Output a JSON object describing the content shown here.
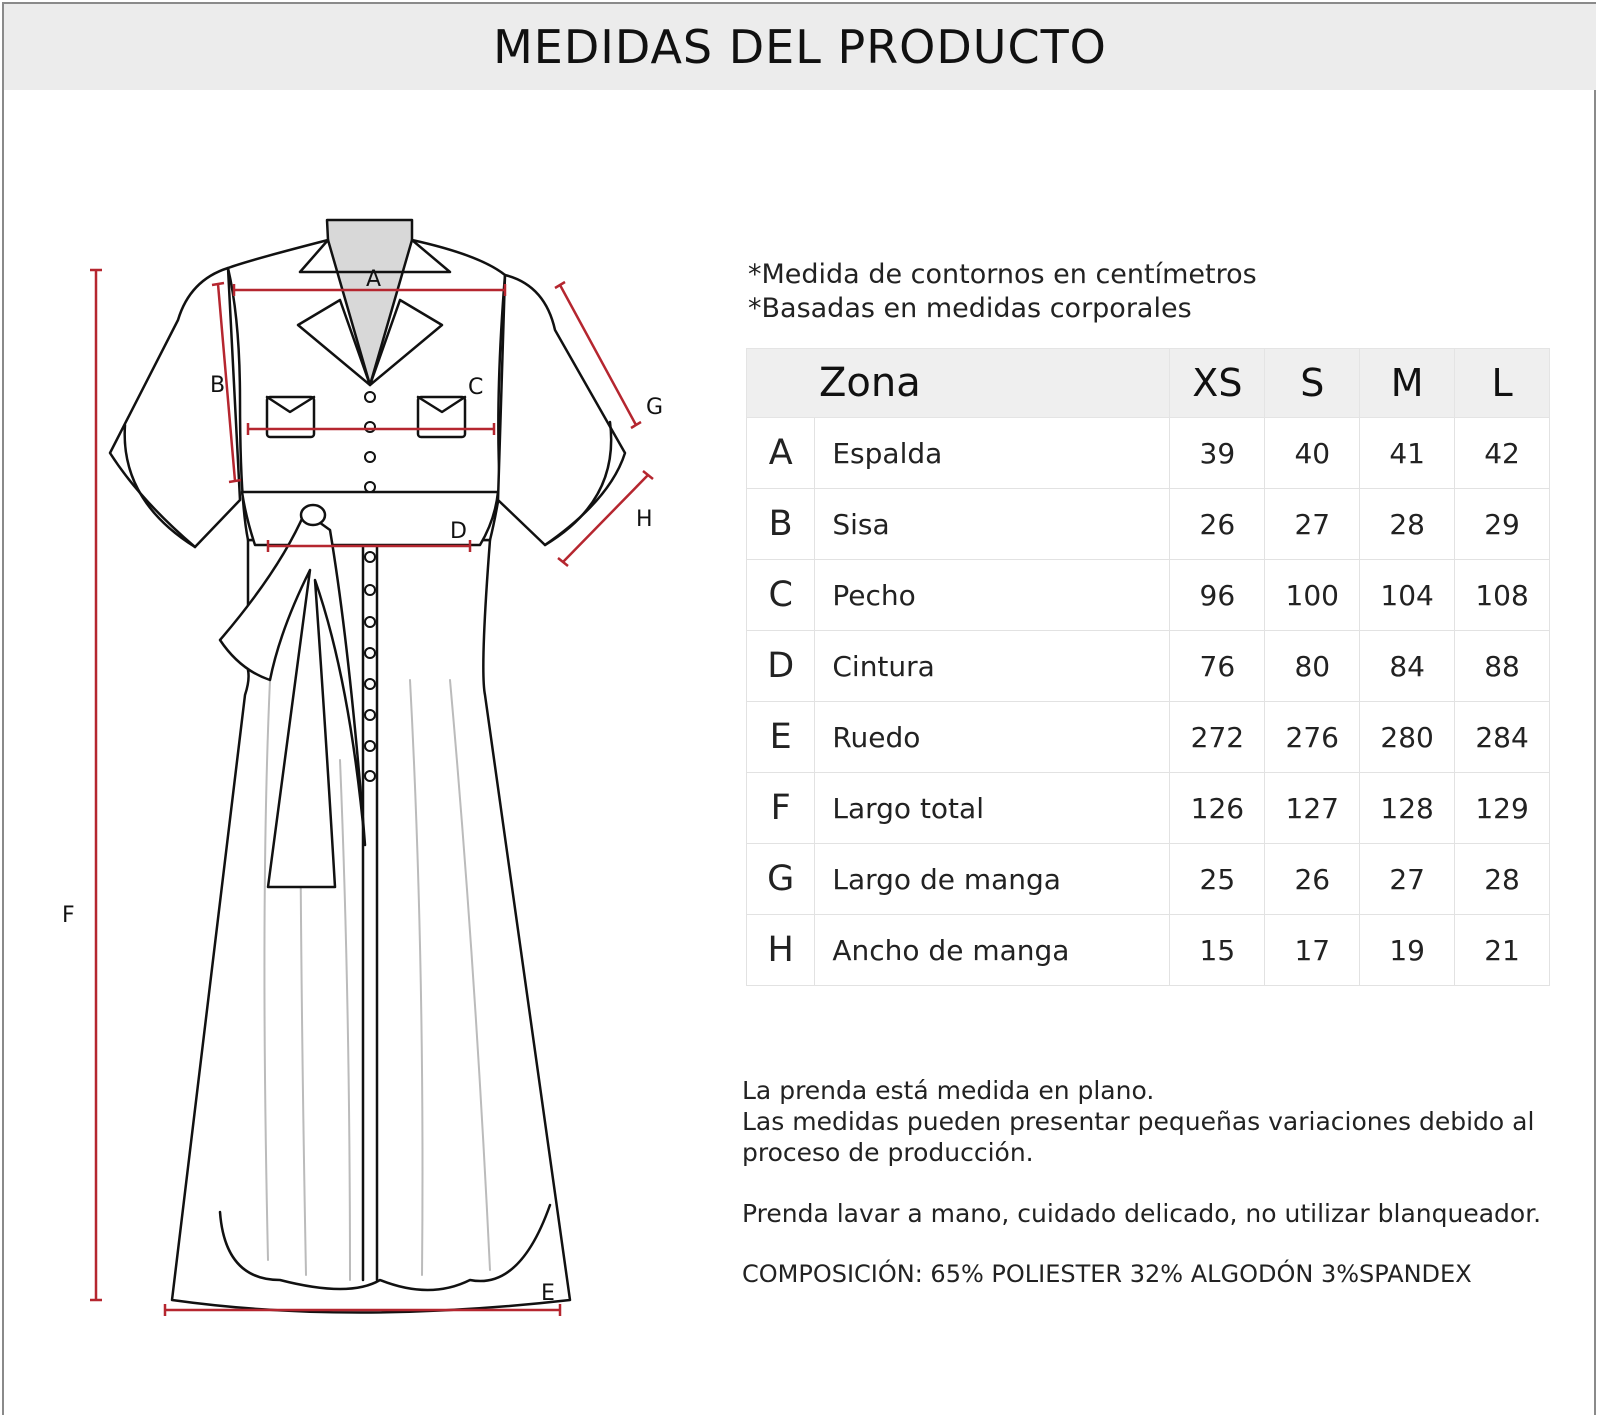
{
  "header": {
    "title": "MEDIDAS DEL PRODUCTO"
  },
  "sketch": {
    "labels": {
      "a": "A",
      "b": "B",
      "c": "C",
      "d": "D",
      "e": "E",
      "f": "F",
      "g": "G",
      "h": "H"
    },
    "colors": {
      "measure_line": "#b5262f",
      "outline": "#111111",
      "collar_fill": "#d8d8d8"
    }
  },
  "notes_top": [
    "*Medida de contornos en centímetros",
    "*Basadas en medidas corporales"
  ],
  "table": {
    "headers": [
      "Zona",
      "XS",
      "S",
      "M",
      "L"
    ],
    "rows": [
      {
        "letter": "A",
        "zone": "Espalda",
        "values": [
          "39",
          "40",
          "41",
          "42"
        ]
      },
      {
        "letter": "B",
        "zone": "Sisa",
        "values": [
          "26",
          "27",
          "28",
          "29"
        ]
      },
      {
        "letter": "C",
        "zone": "Pecho",
        "values": [
          "96",
          "100",
          "104",
          "108"
        ]
      },
      {
        "letter": "D",
        "zone": "Cintura",
        "values": [
          "76",
          "80",
          "84",
          "88"
        ]
      },
      {
        "letter": "E",
        "zone": "Ruedo",
        "values": [
          "272",
          "276",
          "280",
          "284"
        ]
      },
      {
        "letter": "F",
        "zone": "Largo total",
        "values": [
          "126",
          "127",
          "128",
          "129"
        ]
      },
      {
        "letter": "G",
        "zone": "Largo de manga",
        "values": [
          "25",
          "26",
          "27",
          "28"
        ]
      },
      {
        "letter": "H",
        "zone": "Ancho de manga",
        "values": [
          "15",
          "17",
          "19",
          "21"
        ]
      }
    ]
  },
  "notes_bottom": {
    "line1": "La prenda está medida en plano.",
    "line2": "Las medidas pueden presentar pequeñas variaciones debido al",
    "line3": "proceso de producción.",
    "care": "Prenda lavar a mano, cuidado delicado, no utilizar blanqueador.",
    "composition": "COMPOSICIÓN: 65% POLIESTER  32% ALGODÓN  3%SPANDEX"
  }
}
